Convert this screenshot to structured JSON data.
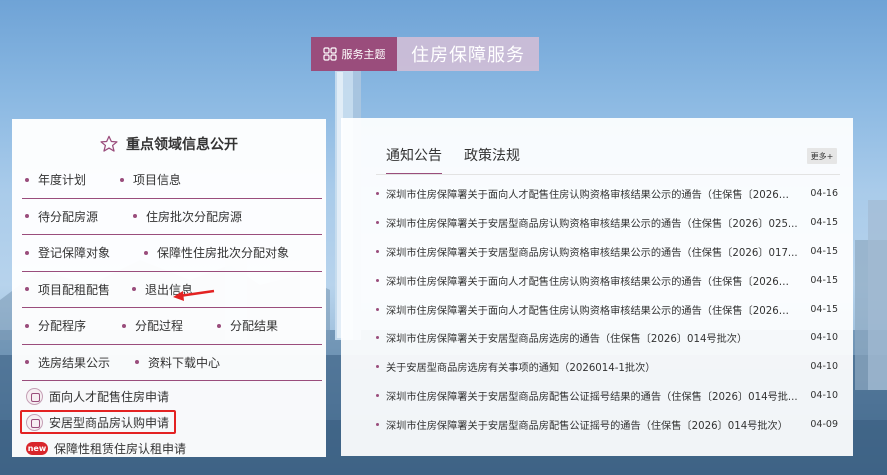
{
  "theme": {
    "tag_label": "服务主题",
    "title": "住房保障服务"
  },
  "left": {
    "title": "重点领域信息公开",
    "rows": [
      [
        "年度计划",
        "项目信息"
      ],
      [
        "待分配房源",
        "住房批次分配房源"
      ],
      [
        "登记保障对象",
        "保障性住房批次分配对象"
      ],
      [
        "项目配租配售",
        "退出信息"
      ],
      [
        "分配程序",
        "分配过程",
        "分配结果"
      ],
      [
        "选房结果公示",
        "资料下载中心"
      ]
    ],
    "apply": [
      "面向人才配售住房申请",
      "安居型商品房认购申请",
      "保障性租赁住房认租申请"
    ],
    "new_badge": "new"
  },
  "right": {
    "tabs": [
      "通知公告",
      "政策法规"
    ],
    "more_label": "更多+",
    "news": [
      {
        "title": "深圳市住房保障署关于面向人才配售住房认购资格审核结果公示的通告（住保售〔2026〕...",
        "date": "04-16"
      },
      {
        "title": "深圳市住房保障署关于安居型商品房认购资格审核结果公示的通告（住保售〔2026〕025...",
        "date": "04-15"
      },
      {
        "title": "深圳市住房保障署关于安居型商品房认购资格审核结果公示的通告（住保售〔2026〕017...",
        "date": "04-15"
      },
      {
        "title": "深圳市住房保障署关于面向人才配售住房认购资格审核结果公示的通告（住保售〔2026〕...",
        "date": "04-15"
      },
      {
        "title": "深圳市住房保障署关于面向人才配售住房认购资格审核结果公示的通告（住保售〔2026〕...",
        "date": "04-15"
      },
      {
        "title": "深圳市住房保障署关于安居型商品房选房的通告（住保售〔2026〕014号批次）",
        "date": "04-10"
      },
      {
        "title": "关于安居型商品房选房有关事项的通知（2026014-1批次）",
        "date": "04-10"
      },
      {
        "title": "深圳市住房保障署关于安居型商品房配售公证摇号结果的通告（住保售〔2026〕014号批...",
        "date": "04-10"
      },
      {
        "title": "深圳市住房保障署关于安居型商品房配售公证摇号的通告（住保售〔2026〕014号批次）",
        "date": "04-09"
      }
    ]
  },
  "colors": {
    "accent": "#9a4d7c",
    "highlight_border": "#e32222",
    "new_badge": "#d9262b"
  },
  "icons": {
    "theme_tag": "grid-icon",
    "left_title": "star-icon",
    "apply": "house-icon",
    "new": "new-badge-icon",
    "annotation": "red-arrow-icon"
  }
}
